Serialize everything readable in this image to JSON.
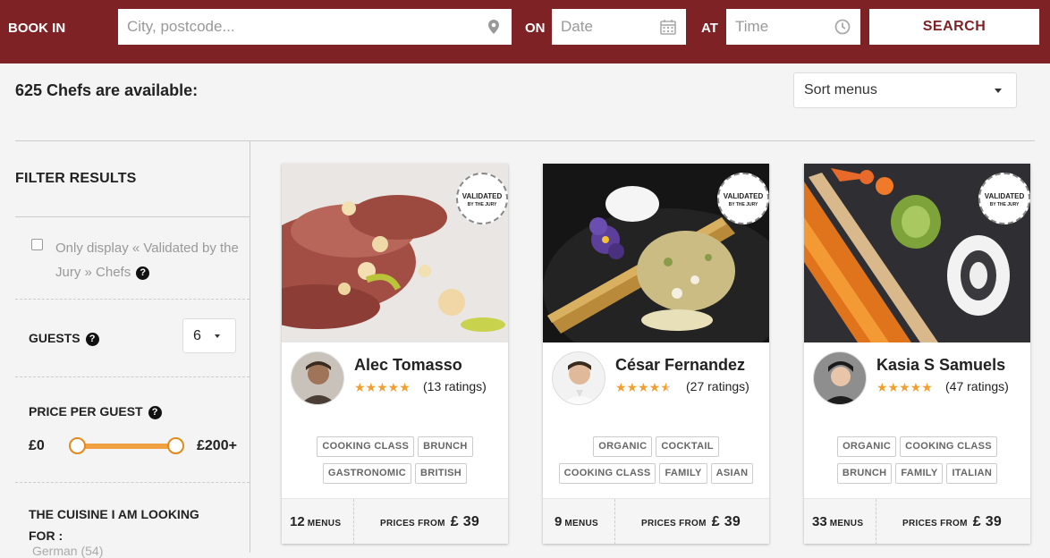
{
  "header": {
    "book_in_label": "BOOK IN",
    "location_placeholder": "City, postcode...",
    "on_label": "ON",
    "date_placeholder": "Date",
    "at_label": "AT",
    "time_placeholder": "Time",
    "search_label": "SEARCH",
    "brand_color": "#7e2226"
  },
  "results": {
    "count_text": "625 Chefs are available:",
    "sort_label": "Sort menus"
  },
  "sidebar": {
    "title": "FILTER RESULTS",
    "validated_text": "Only display « Validated by the Jury » Chefs",
    "guests_label": "GUESTS",
    "guests_value": "6",
    "price_label": "PRICE PER GUEST",
    "price_min": "£0",
    "price_max": "£200+",
    "cuisine_label": "THE CUISINE I AM LOOKING FOR :",
    "cuisine_first_item": "German (54)"
  },
  "badge": {
    "line1": "VALIDATED",
    "line2": "BY THE JURY"
  },
  "chefs": [
    {
      "name": "Alec Tomasso",
      "rating": 5,
      "ratings_text": "(13 ratings)",
      "tags_row1": [
        "COOKING CLASS",
        "BRUNCH"
      ],
      "tags_row2": [
        "GASTRONOMIC",
        "BRITISH"
      ],
      "menus_count": "12",
      "menus_label": "MENUS",
      "prices_label": "PRICES FROM",
      "price": "£ 39"
    },
    {
      "name": "César Fernandez",
      "rating": 4.5,
      "ratings_text": "(27 ratings)",
      "tags_row1": [
        "ORGANIC",
        "COCKTAIL"
      ],
      "tags_row2": [
        "COOKING CLASS",
        "FAMILY",
        "ASIAN"
      ],
      "menus_count": "9",
      "menus_label": "MENUS",
      "prices_label": "PRICES FROM",
      "price": "£ 39"
    },
    {
      "name": "Kasia S Samuels",
      "rating": 5,
      "ratings_text": "(47 ratings)",
      "tags_row1": [
        "ORGANIC",
        "COOKING CLASS"
      ],
      "tags_row2": [
        "BRUNCH",
        "FAMILY",
        "ITALIAN"
      ],
      "menus_count": "33",
      "menus_label": "MENUS",
      "prices_label": "PRICES FROM",
      "price": "£ 39"
    }
  ]
}
